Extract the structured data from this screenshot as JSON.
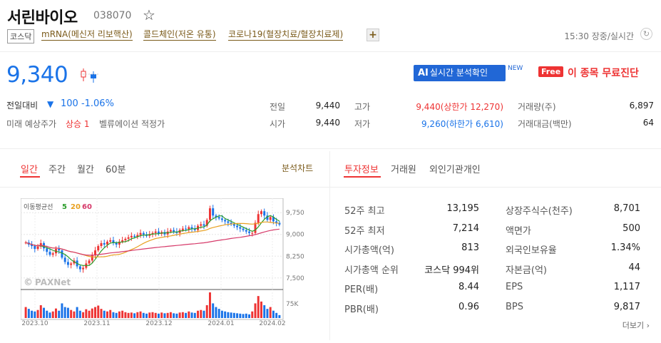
{
  "header": {
    "name": "서린바이오",
    "code": "038070",
    "market": "코스닥",
    "tags": [
      "mRNA(메신저 리보핵산)",
      "콜드체인(저온 유통)",
      "코로나19(혈장치료/혈장치료제)"
    ],
    "time": "15:30 장중/실시간"
  },
  "price": {
    "current": "9,340",
    "change_label": "전일대비",
    "change": "100  -1.06%",
    "forecast_label": "미래 예상주가",
    "forecast_value": "상승 1",
    "valuation": "벨류에이션  적정가"
  },
  "buttons": {
    "ai_prefix": "AI",
    "ai_label": "실시간 분석확인",
    "new_badge": "NEW",
    "free_badge": "Free",
    "free_label": "이 종목 무료진단"
  },
  "quote": {
    "prev_label": "전일",
    "prev": "9,440",
    "open_label": "시가",
    "open": "9,440",
    "high_label": "고가",
    "high": "9,440(상한가 12,270)",
    "low_label": "저가",
    "low": "9,260(하한가 6,610)",
    "volume_label": "거래량(주)",
    "volume": "6,897",
    "amount_label": "거래대금(백만)",
    "amount": "64"
  },
  "chart_tabs": [
    "일간",
    "주간",
    "월간",
    "60분"
  ],
  "chart_link": "분석차트",
  "info_tabs": [
    "투자정보",
    "거래원",
    "외인기관개인"
  ],
  "chart_data": {
    "type": "candlestick",
    "legend_label": "이동평균선",
    "ma_periods": [
      "5",
      "20",
      "60"
    ],
    "ma_colors": [
      "#2a9d2a",
      "#e8a020",
      "#d63a6a"
    ],
    "watermark": "PAXNet",
    "y_ticks": [
      "9,750",
      "9,000",
      "8,250",
      "7,500"
    ],
    "ylim": [
      7200,
      10050
    ],
    "vol_tick": "75K",
    "x_ticks": [
      "2023.10",
      "2023.11",
      "2023.12",
      "2024.01",
      "2024.02"
    ],
    "closes": [
      8720,
      8650,
      8600,
      8500,
      8580,
      8700,
      8520,
      8400,
      8300,
      8350,
      8500,
      8450,
      8200,
      8050,
      7950,
      8000,
      8100,
      7900,
      7800,
      7850,
      8000,
      8100,
      8300,
      8450,
      8600,
      8700,
      8650,
      8750,
      8800,
      8700,
      8650,
      8750,
      8800,
      8850,
      8900,
      8950,
      8920,
      8980,
      9050,
      9000,
      8950,
      9000,
      9050,
      9100,
      9020,
      9080,
      9000,
      9100,
      9150,
      9100,
      9050,
      9150,
      9200,
      9180,
      9250,
      9200,
      9150,
      9300,
      9350,
      9300,
      9500,
      9900,
      9650,
      9600,
      9550,
      9500,
      9450,
      9400,
      9350,
      9300,
      9250,
      9200,
      9150,
      9100,
      9050,
      9050,
      9400,
      9700,
      9800,
      9650,
      9500,
      9600,
      9450,
      9400,
      9340
    ],
    "volumes": [
      30,
      25,
      20,
      18,
      22,
      35,
      28,
      20,
      15,
      18,
      26,
      20,
      40,
      30,
      28,
      22,
      18,
      30,
      20,
      16,
      24,
      20,
      26,
      30,
      34,
      25,
      20,
      18,
      22,
      16,
      14,
      18,
      20,
      16,
      14,
      15,
      13,
      16,
      18,
      14,
      12,
      15,
      16,
      14,
      12,
      15,
      13,
      14,
      16,
      13,
      12,
      15,
      16,
      14,
      18,
      15,
      14,
      20,
      22,
      20,
      35,
      70,
      40,
      30,
      25,
      20,
      18,
      16,
      15,
      14,
      13,
      12,
      11,
      12,
      10,
      18,
      40,
      60,
      45,
      35,
      25,
      30,
      20,
      14,
      8
    ]
  },
  "info": [
    {
      "label": "52주 최고",
      "value": "13,195",
      "label2": "상장주식수(천주)",
      "value2": "8,701"
    },
    {
      "label": "52주 최저",
      "value": "7,214",
      "label2": "액면가",
      "value2": "500"
    },
    {
      "label": "시가총액(억)",
      "value": "813",
      "label2": "외국인보유율",
      "value2": "1.34%"
    },
    {
      "label": "시가총액 순위",
      "value": "코스닥 994위",
      "label2": "자본금(억)",
      "value2": "44"
    },
    {
      "label": "PER(배)",
      "value": "8.44",
      "label2": "EPS",
      "value2": "1,117"
    },
    {
      "label": "PBR(배)",
      "value": "0.96",
      "label2": "BPS",
      "value2": "9,817"
    }
  ],
  "more_link": "더보기 ›"
}
